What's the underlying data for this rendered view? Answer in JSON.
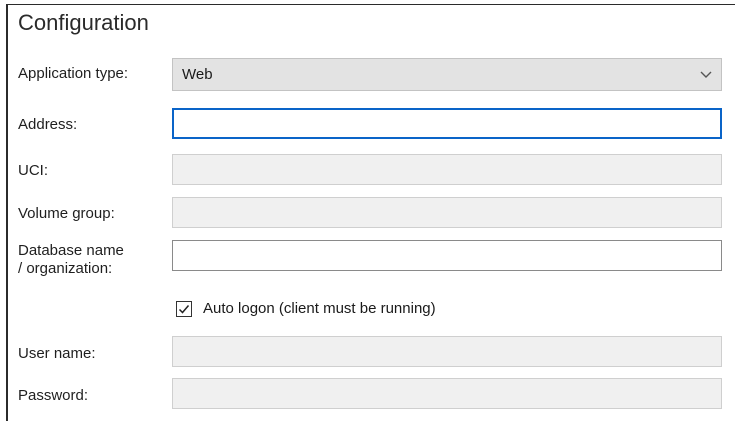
{
  "section": {
    "title": "Configuration"
  },
  "fields": {
    "application_type": {
      "label": "Application type:",
      "value": "Web"
    },
    "address": {
      "label": "Address:",
      "value": ""
    },
    "uci": {
      "label": "UCI:",
      "value": ""
    },
    "volume_group": {
      "label": "Volume group:",
      "value": ""
    },
    "database_name": {
      "label_line1": "Database name",
      "label_line2": "/ organization:",
      "value": ""
    },
    "auto_logon": {
      "label": "Auto logon (client must be running)",
      "checked": true
    },
    "user_name": {
      "label": "User name:",
      "value": ""
    },
    "password": {
      "label": "Password:",
      "value": ""
    }
  },
  "colors": {
    "focus_border": "#0a64c8",
    "disabled_fill": "#f0f0f0"
  },
  "icons": {
    "dropdown": "chevron-down-icon",
    "checkbox": "checkmark-icon"
  }
}
